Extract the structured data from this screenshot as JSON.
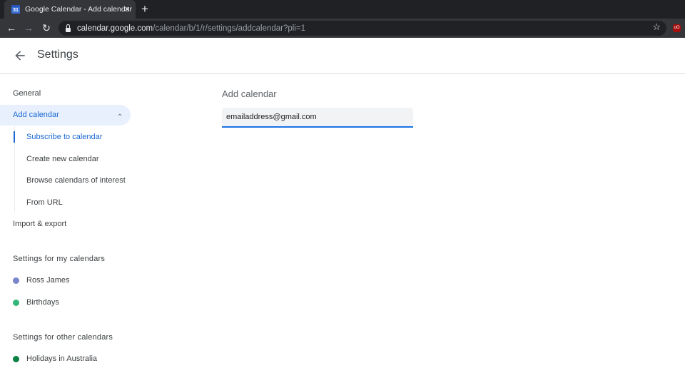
{
  "browser": {
    "tab": {
      "favicon_text": "31",
      "title": "Google Calendar - Add calendar",
      "close_glyph": "×"
    },
    "new_tab_glyph": "+",
    "nav": {
      "back_glyph": "←",
      "forward_glyph": "→",
      "reload_glyph": "↻"
    },
    "url": {
      "domain": "calendar.google.com",
      "path": "/calendar/b/1/r/settings/addcalendar?pli=1"
    },
    "star_glyph": "☆",
    "extension_label": "uO"
  },
  "header": {
    "title": "Settings"
  },
  "sidebar": {
    "general": "General",
    "add_calendar": "Add calendar",
    "sub_items": [
      {
        "label": "Subscribe to calendar",
        "active": true
      },
      {
        "label": "Create new calendar",
        "active": false
      },
      {
        "label": "Browse calendars of interest",
        "active": false
      },
      {
        "label": "From URL",
        "active": false
      }
    ],
    "import_export": "Import & export",
    "my_calendars_heading": "Settings for my calendars",
    "my_calendars": [
      {
        "label": "Ross James",
        "color": "#7986cb"
      },
      {
        "label": "Birthdays",
        "color": "#33b679"
      }
    ],
    "other_calendars_heading": "Settings for other calendars",
    "other_calendars": [
      {
        "label": "Holidays in Australia",
        "color": "#0b8043"
      }
    ]
  },
  "main": {
    "heading": "Add calendar",
    "input_value": "emailaddress@gmail.com"
  }
}
